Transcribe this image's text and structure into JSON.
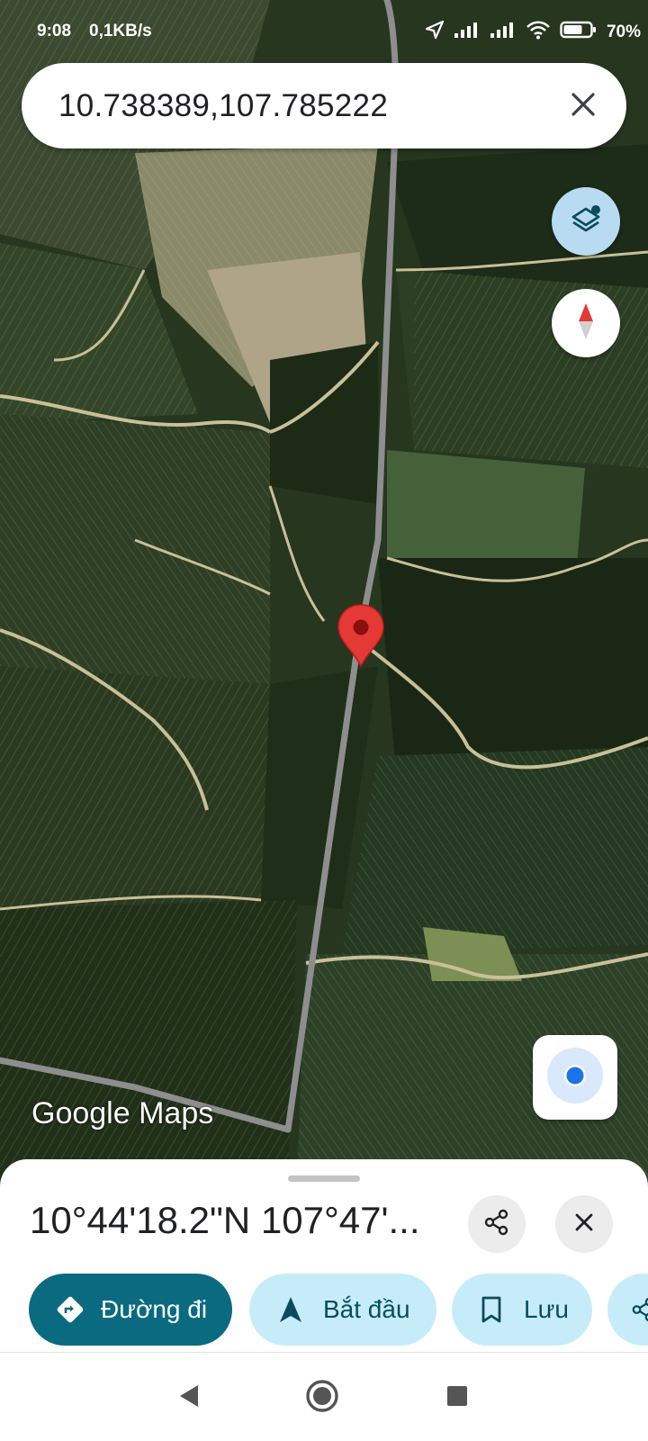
{
  "status_bar": {
    "time": "9:08",
    "network_speed": "0,1KB/s",
    "battery": "70%",
    "icons": [
      "location-arrow-icon",
      "signal-icon",
      "signal-icon",
      "wifi-icon",
      "battery-icon"
    ]
  },
  "search": {
    "query": "10.738389,107.785222",
    "clear_icon": "close-icon"
  },
  "map": {
    "layers_icon": "layers-icon",
    "compass_icon": "compass-icon",
    "my_location_icon": "my-location-icon",
    "marker_icon": "map-pin-icon",
    "watermark": "Google Maps",
    "colors": {
      "pin": "#e53935",
      "road": "#8e8e8e",
      "layers_button": "#b9dbf1"
    }
  },
  "place_sheet": {
    "title": "10°44'18.2\"N 107°47'...",
    "share_icon": "share-icon",
    "close_icon": "close-icon",
    "actions": [
      {
        "label": "Đường đi",
        "icon": "directions-icon"
      },
      {
        "label": "Bắt đầu",
        "icon": "navigation-arrow-icon"
      },
      {
        "label": "Lưu",
        "icon": "bookmark-icon"
      },
      {
        "label": "",
        "icon": "share-icon"
      }
    ],
    "colors": {
      "primary_chip": "#0a6a80",
      "secondary_chip": "#c7ecf9"
    }
  },
  "nav_bar": {
    "buttons": [
      "back-triangle-icon",
      "home-circle-icon",
      "recents-square-icon"
    ]
  }
}
